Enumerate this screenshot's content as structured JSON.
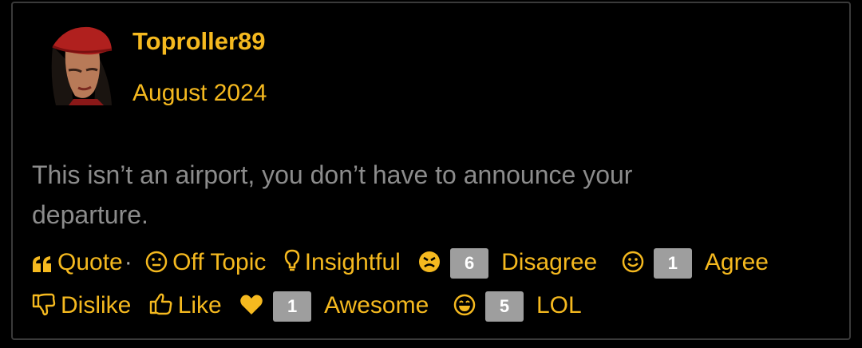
{
  "post": {
    "author": "Toproller89",
    "date": "August 2024",
    "body": "This isn’t an airport, you don’t have to announce your departure."
  },
  "reactions": {
    "quote": "Quote",
    "separator": "·",
    "off_topic": "Off Topic",
    "insightful": "Insightful",
    "disagree_count": "6",
    "disagree": "Disagree",
    "agree_count": "1",
    "agree": "Agree",
    "dislike": "Dislike",
    "like": "Like",
    "awesome_count": "1",
    "awesome": "Awesome",
    "lol_count": "5",
    "lol": "LOL"
  },
  "colors": {
    "accent": "#f5b91f",
    "body_text": "#8c8c8c",
    "count_badge": "#9e9e9e",
    "border": "#3a3a3a"
  }
}
